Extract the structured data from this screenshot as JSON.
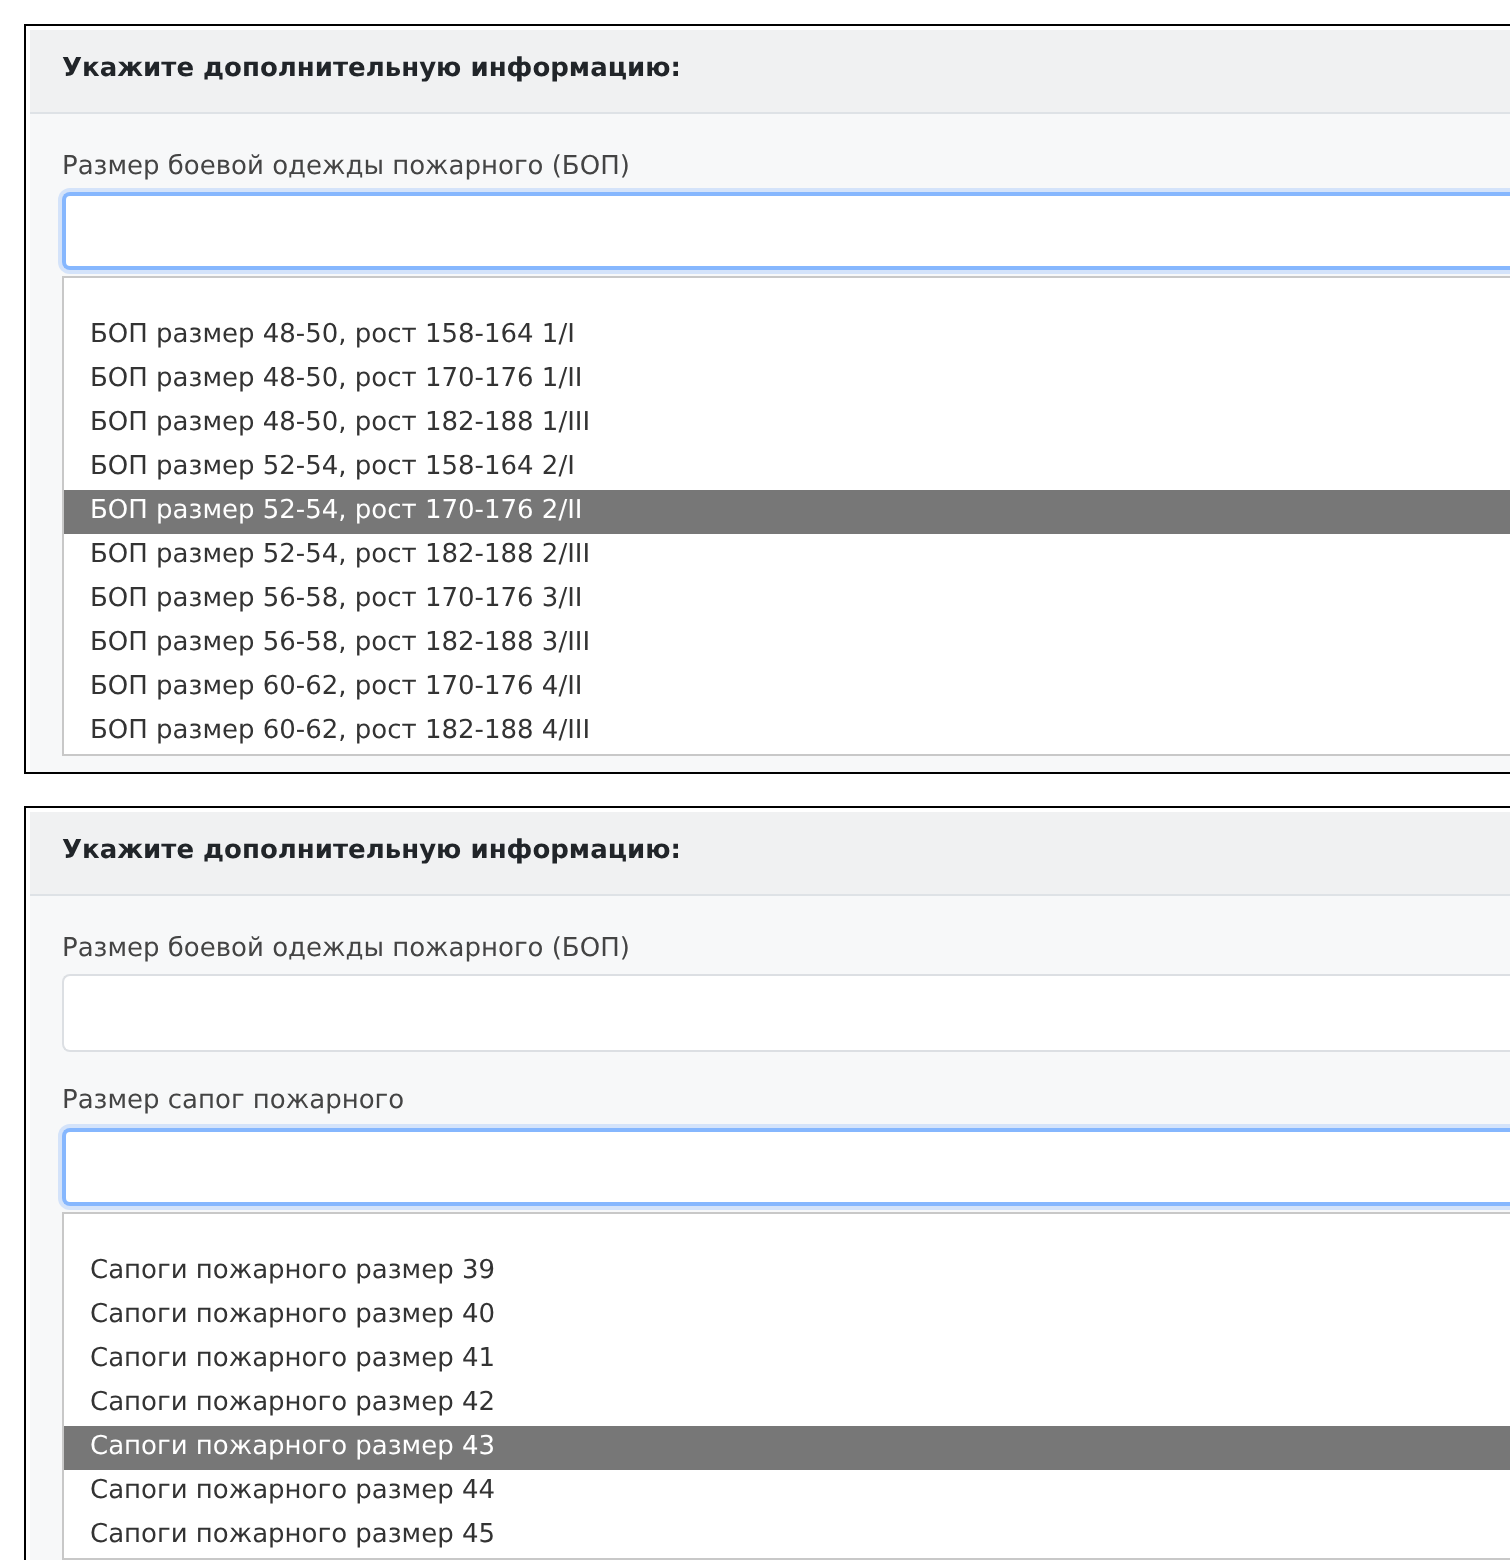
{
  "panels": [
    {
      "header": "Укажите дополнительную информацию:",
      "fields": [
        {
          "label": "Размер боевой одежды пожарного (БОП)",
          "focused": true,
          "dropdown": {
            "options": [
              {
                "label": "БОП размер 48-50, рост 158-164 1/I",
                "selected": false
              },
              {
                "label": "БОП размер 48-50, рост 170-176 1/II",
                "selected": false
              },
              {
                "label": "БОП размер 48-50, рост 182-188 1/III",
                "selected": false
              },
              {
                "label": "БОП размер 52-54, рост 158-164 2/I",
                "selected": false
              },
              {
                "label": "БОП размер 52-54, рост 170-176 2/II",
                "selected": true
              },
              {
                "label": "БОП размер 52-54, рост 182-188 2/III",
                "selected": false
              },
              {
                "label": "БОП размер 56-58, рост 170-176 3/II",
                "selected": false
              },
              {
                "label": "БОП размер 56-58, рост 182-188 3/III",
                "selected": false
              },
              {
                "label": "БОП размер 60-62, рост 170-176 4/II",
                "selected": false
              },
              {
                "label": "БОП размер 60-62, рост 182-188 4/III",
                "selected": false
              }
            ]
          }
        }
      ]
    },
    {
      "header": "Укажите дополнительную информацию:",
      "fields": [
        {
          "label": "Размер боевой одежды пожарного (БОП)",
          "focused": false
        },
        {
          "label": "Размер сапог пожарного",
          "focused": true,
          "dropdown": {
            "options": [
              {
                "label": "Сапоги пожарного размер 39",
                "selected": false
              },
              {
                "label": "Сапоги пожарного размер 40",
                "selected": false
              },
              {
                "label": "Сапоги пожарного размер 41",
                "selected": false
              },
              {
                "label": "Сапоги пожарного размер 42",
                "selected": false
              },
              {
                "label": "Сапоги пожарного размер 43",
                "selected": true
              },
              {
                "label": "Сапоги пожарного размер 44",
                "selected": false
              },
              {
                "label": "Сапоги пожарного размер 45",
                "selected": false
              }
            ]
          }
        }
      ]
    }
  ]
}
